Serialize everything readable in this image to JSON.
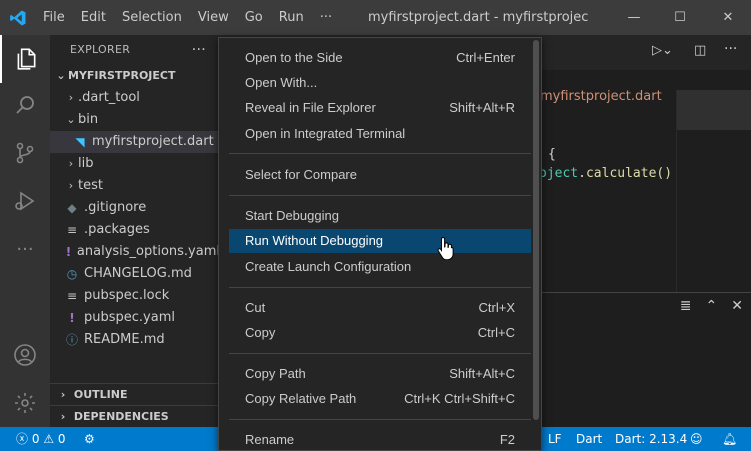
{
  "titlebar": {
    "menu": [
      "File",
      "Edit",
      "Selection",
      "View",
      "Go",
      "Run",
      "···"
    ],
    "window_title": "myfirstproject.dart - myfirstproject - Visual S",
    "controls": {
      "minimize": "—",
      "maximize": "☐",
      "close": "✕"
    }
  },
  "colors": {
    "accent": "#007acc",
    "highlight": "#094771",
    "string": "#ce9178"
  },
  "explorer": {
    "title": "EXPLORER",
    "more": "···",
    "project": "MYFIRSTPROJECT",
    "items": [
      {
        "label": ".dart_tool",
        "type": "folder",
        "state": "collapsed"
      },
      {
        "label": "bin",
        "type": "folder",
        "state": "expanded"
      },
      {
        "label": "myfirstproject.dart",
        "type": "dart-file",
        "selected": true
      },
      {
        "label": "lib",
        "type": "folder",
        "state": "collapsed"
      },
      {
        "label": "test",
        "type": "folder",
        "state": "collapsed"
      },
      {
        "label": ".gitignore",
        "type": "git-file"
      },
      {
        "label": ".packages",
        "type": "list-file"
      },
      {
        "label": "analysis_options.yaml",
        "type": "yaml-file"
      },
      {
        "label": "CHANGELOG.md",
        "type": "changelog-file"
      },
      {
        "label": "pubspec.lock",
        "type": "list-file"
      },
      {
        "label": "pubspec.yaml",
        "type": "yaml-file"
      },
      {
        "label": "README.md",
        "type": "info-file"
      }
    ],
    "outline": "OUTLINE",
    "dependencies": "DEPENDENCIES"
  },
  "editor": {
    "breadcrumb": "myfirstproject.dart",
    "code_line1": "{",
    "code_line2_obj": "oject",
    "code_line2_rest": ".calculate()"
  },
  "context_menu": {
    "groups": [
      [
        {
          "label": "Open to the Side",
          "shortcut": "Ctrl+Enter"
        },
        {
          "label": "Open With...",
          "shortcut": ""
        },
        {
          "label": "Reveal in File Explorer",
          "shortcut": "Shift+Alt+R"
        },
        {
          "label": "Open in Integrated Terminal",
          "shortcut": ""
        }
      ],
      [
        {
          "label": "Select for Compare",
          "shortcut": ""
        }
      ],
      [
        {
          "label": "Start Debugging",
          "shortcut": ""
        },
        {
          "label": "Run Without Debugging",
          "shortcut": "",
          "highlighted": true
        },
        {
          "label": "Create Launch Configuration",
          "shortcut": ""
        }
      ],
      [
        {
          "label": "Cut",
          "shortcut": "Ctrl+X"
        },
        {
          "label": "Copy",
          "shortcut": "Ctrl+C"
        }
      ],
      [
        {
          "label": "Copy Path",
          "shortcut": "Shift+Alt+C"
        },
        {
          "label": "Copy Relative Path",
          "shortcut": "Ctrl+K Ctrl+Shift+C"
        }
      ],
      [
        {
          "label": "Rename",
          "shortcut": "F2"
        }
      ]
    ]
  },
  "statusbar": {
    "errors": "0",
    "warnings": "0",
    "eol": "LF",
    "language": "Dart",
    "sdk": "Dart: 2.13.4"
  }
}
